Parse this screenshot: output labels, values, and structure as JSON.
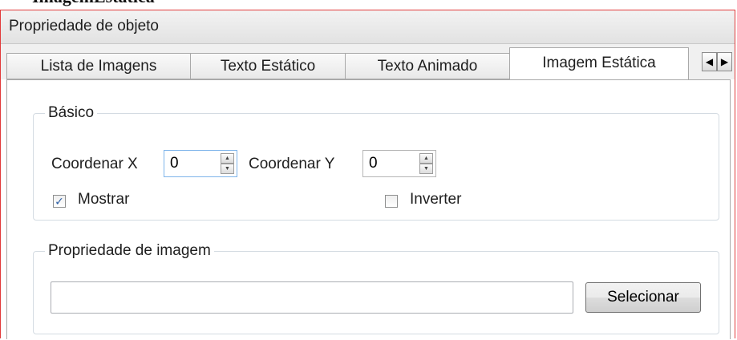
{
  "header": {
    "clipped_title": "ImagemEstática"
  },
  "window": {
    "title": "Propriedade de objeto"
  },
  "tabs": [
    {
      "label": "Lista de Imagens"
    },
    {
      "label": "Texto Estático"
    },
    {
      "label": "Texto Animado"
    },
    {
      "label": "Imagem Estática"
    }
  ],
  "tab_scroll": {
    "left_glyph": "◀",
    "right_glyph": "▶"
  },
  "basic": {
    "title": "Básico",
    "coord_x_label": "Coordenar X",
    "coord_x_value": "0",
    "coord_y_label": "Coordenar Y",
    "coord_y_value": "0",
    "show_label": "Mostrar",
    "show_checked": true,
    "invert_label": "Inverter",
    "invert_checked": false
  },
  "image": {
    "title": "Propriedade de imagem",
    "path_value": "",
    "select_label": "Selecionar"
  },
  "colors": {
    "panel_border": "#e23b3b",
    "spin_focus_border": "#7eb4ea",
    "check_mark": "#2d5fa5"
  },
  "icons": {
    "spin_up": "▲",
    "spin_down": "▼",
    "check": "✓"
  }
}
